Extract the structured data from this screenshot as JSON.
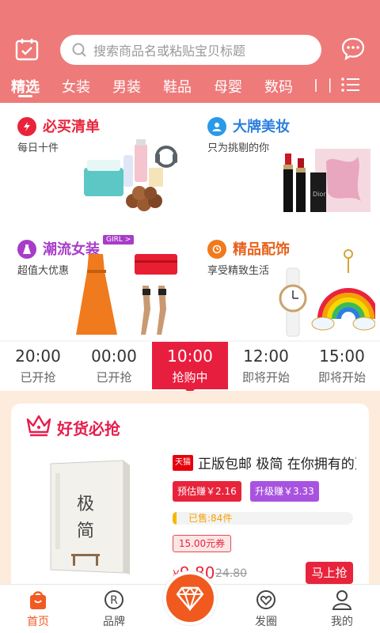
{
  "search": {
    "placeholder": "搜索商品名或粘贴宝贝标题"
  },
  "tabs": [
    "精选",
    "女装",
    "男装",
    "鞋品",
    "母婴",
    "数码"
  ],
  "categories": [
    {
      "title": "必买清单",
      "subtitle": "每日十件",
      "color": "#e8243c"
    },
    {
      "title": "大牌美妆",
      "subtitle": "只为挑剔的你",
      "color": "#2a9ae8"
    },
    {
      "title": "潮流女装",
      "subtitle": "超值大优惠",
      "badge": "GIRL >",
      "color": "#a83cc9"
    },
    {
      "title": "精品配饰",
      "subtitle": "享受精致生活",
      "color": "#f07a1e"
    }
  ],
  "time_slots": [
    {
      "time": "20:00",
      "status": "已开抢"
    },
    {
      "time": "00:00",
      "status": "已开抢"
    },
    {
      "time": "10:00",
      "status": "抢购中"
    },
    {
      "time": "12:00",
      "status": "即将开始"
    },
    {
      "time": "15:00",
      "status": "即将开始"
    }
  ],
  "card": {
    "title": "好货必抢",
    "product": {
      "shop_badge": "天猫",
      "name": "正版包邮 极简 在你拥有的更多...",
      "chip_estimate": "预估赚￥2.16",
      "chip_upgrade": "升级赚￥3.33",
      "sold": "已售:84件",
      "sold_fraction": 0.02,
      "coupon": "15.00元券",
      "price_currency": "¥",
      "price": "9.80",
      "old_price": "24.80",
      "buy_label": "马上抢",
      "book_title_1": "极",
      "book_title_2": "简"
    }
  },
  "bottom_nav": [
    {
      "label": "首页",
      "icon": "home-bag-icon",
      "active": true
    },
    {
      "label": "品牌",
      "icon": "registered-icon",
      "active": false
    },
    {
      "label": "",
      "icon": "diamond-icon",
      "active": false
    },
    {
      "label": "发圈",
      "icon": "heart-circle-icon",
      "active": false
    },
    {
      "label": "我的",
      "icon": "user-icon",
      "active": false
    }
  ],
  "colors": {
    "header": "#ee7a7a",
    "accent": "#e8243c",
    "nav_active": "#f25a23"
  }
}
